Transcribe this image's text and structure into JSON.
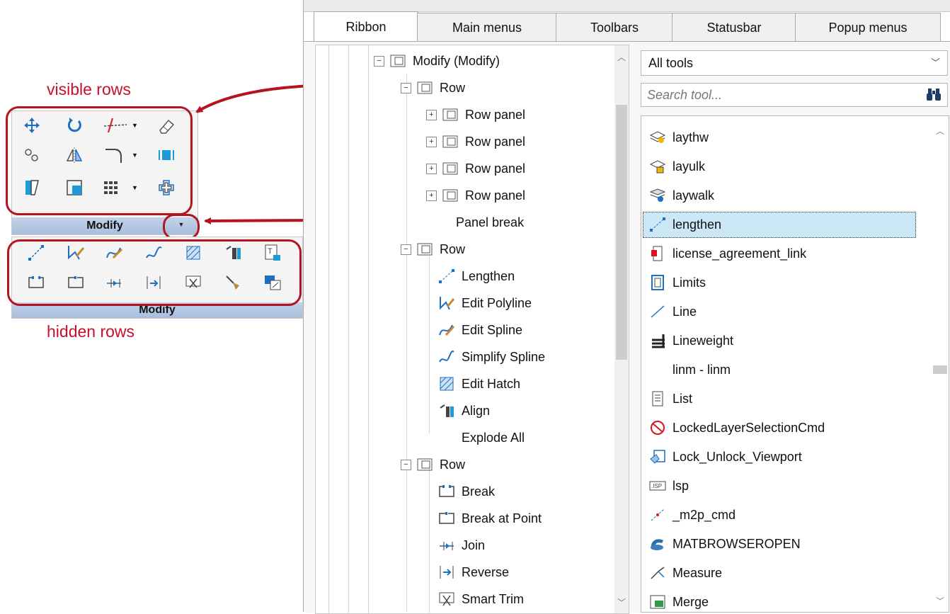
{
  "callouts": {
    "visible_rows": "visible rows",
    "hidden_rows": "hidden rows"
  },
  "ribbon": {
    "panel_title_top": "Modify",
    "panel_title_bottom": "Modify"
  },
  "tabs": [
    "Ribbon",
    "Main menus",
    "Toolbars",
    "Statusbar",
    "Popup menus"
  ],
  "tree": {
    "root": "Modify (Modify)",
    "row1": "Row",
    "row_panels": [
      "Row panel",
      "Row panel",
      "Row panel",
      "Row panel"
    ],
    "panel_break": "Panel break",
    "row2": "Row",
    "row2_items": [
      "Lengthen",
      "Edit Polyline",
      "Edit Spline",
      "Simplify Spline",
      "Edit Hatch",
      "Align",
      "Explode All"
    ],
    "row3": "Row",
    "row3_items": [
      "Break",
      "Break at Point",
      "Join",
      "Reverse",
      "Smart Trim"
    ]
  },
  "tools": {
    "filter": "All tools",
    "search_placeholder": "Search tool...",
    "items": [
      "laythw",
      "layulk",
      "laywalk",
      "lengthen",
      "license_agreement_link",
      "Limits",
      "Line",
      "Lineweight",
      "linm - linm",
      "List",
      "LockedLayerSelectionCmd",
      "Lock_Unlock_Viewport",
      "lsp",
      "_m2p_cmd",
      "MATBROWSEROPEN",
      "Measure",
      "Merge"
    ],
    "selected": "lengthen"
  },
  "colors": {
    "annotation": "#b3141f",
    "selection": "#cce8f7",
    "panel_title": "#a7bedd"
  }
}
